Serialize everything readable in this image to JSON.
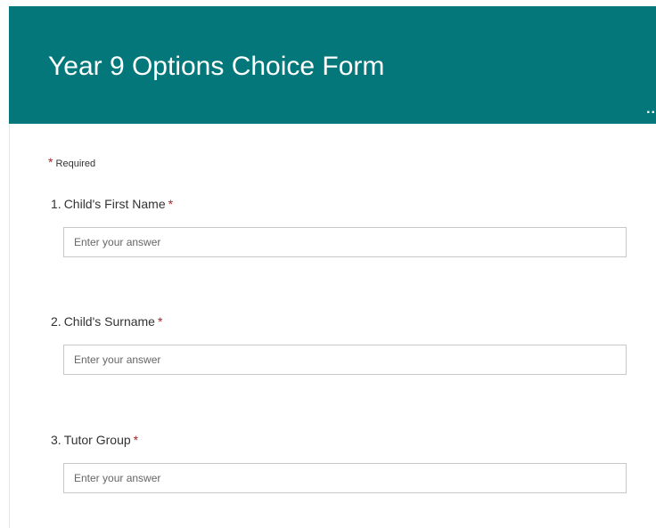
{
  "form": {
    "title": "Year 9 Options Choice Form",
    "more_glyph": "..",
    "required_asterisk": "*",
    "required_text": "Required"
  },
  "questions": [
    {
      "number": "1.",
      "label": "Child's First Name",
      "required_mark": "*",
      "placeholder": "Enter your answer",
      "value": ""
    },
    {
      "number": "2.",
      "label": "Child's Surname",
      "required_mark": "*",
      "placeholder": "Enter your answer",
      "value": ""
    },
    {
      "number": "3.",
      "label": "Tutor Group",
      "required_mark": "*",
      "placeholder": "Enter your answer",
      "value": ""
    }
  ],
  "colors": {
    "header_background": "#04777b",
    "required_red": "#a4262c"
  }
}
